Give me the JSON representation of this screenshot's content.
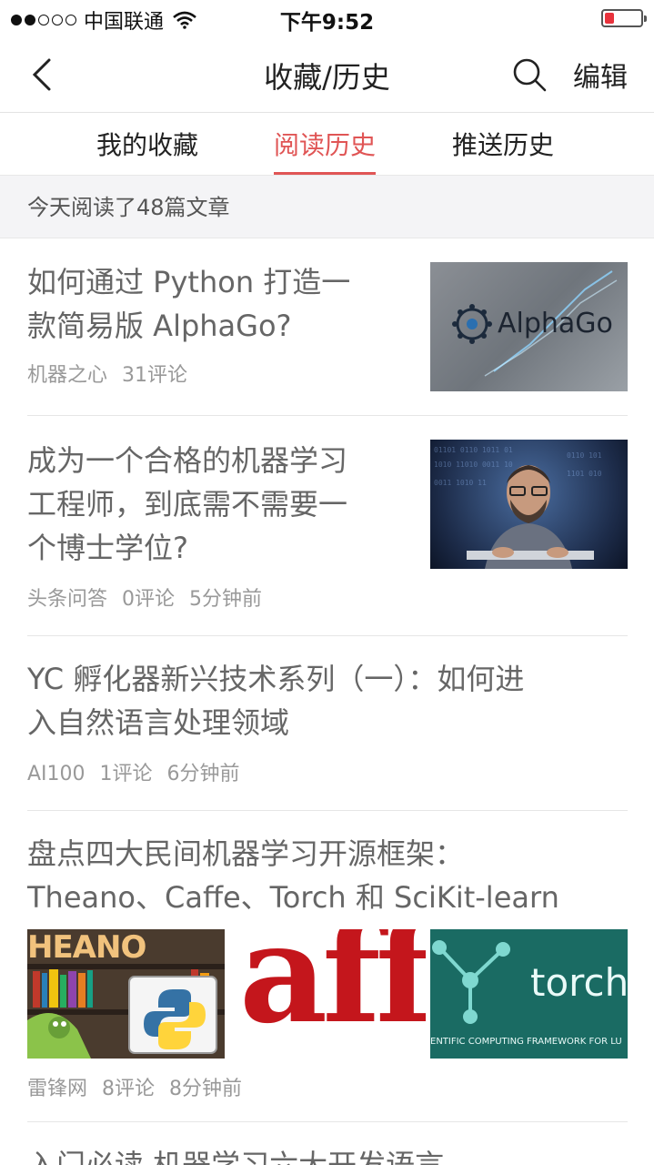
{
  "status_bar": {
    "carrier": "中国联通",
    "time": "下午9:52"
  },
  "nav": {
    "title": "收藏/历史",
    "edit_label": "编辑"
  },
  "tabs": [
    {
      "label": "我的收藏",
      "active": false
    },
    {
      "label": "阅读历史",
      "active": true
    },
    {
      "label": "推送历史",
      "active": false
    }
  ],
  "summary": "今天阅读了48篇文章",
  "articles": [
    {
      "title_line1": "如何通过 Python 打造一",
      "title_line2": "款简易版 AlphaGo?",
      "source": "机器之心",
      "comments": "31评论",
      "thumb_text": "AlphaGo"
    },
    {
      "title_line1": "成为一个合格的机器学习",
      "title_line2": "工程师，到底需不需要一",
      "title_line3": "个博士学位?",
      "source": "头条问答",
      "comments": "0评论",
      "time": "5分钟前"
    },
    {
      "title_line1": "YC 孵化器新兴技术系列（一）：如何进",
      "title_line2": "入自然语言处理领域",
      "source": "AI100",
      "comments": "1评论",
      "time": "6分钟前"
    },
    {
      "title_line1": "盘点四大民间机器学习开源框架：",
      "title_line2": "Theano、Caffe、Torch 和 SciKit-learn",
      "source": "雷锋网",
      "comments": "8评论",
      "time": "8分钟前",
      "thumb_theano_text": "HEANO",
      "thumb_caffe_text": "aff",
      "thumb_torch_text": "torch",
      "thumb_torch_caption": "ENTIFIC COMPUTING FRAMEWORK FOR LU"
    },
    {
      "title_line1": "入门必读 机器学习六大开发语言"
    }
  ]
}
